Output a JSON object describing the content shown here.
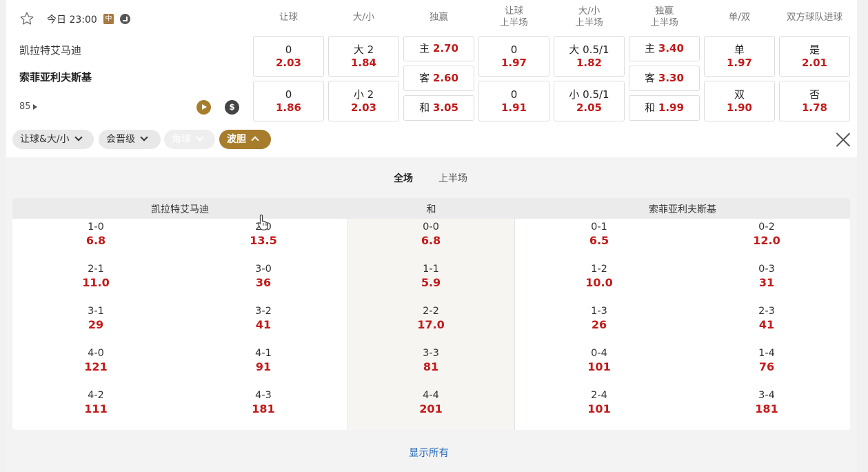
{
  "match": {
    "time": "今日 23:00",
    "badge": "中",
    "home": "凯拉特艾马迪",
    "away": "索菲亚利夫斯基",
    "minute": "85"
  },
  "headers": [
    {
      "l1": "让球",
      "l2": ""
    },
    {
      "l1": "大/小",
      "l2": ""
    },
    {
      "l1": "独赢",
      "l2": ""
    },
    {
      "l1": "让球",
      "l2": "上半场"
    },
    {
      "l1": "大/小",
      "l2": "上半场"
    },
    {
      "l1": "独赢",
      "l2": "上半场"
    },
    {
      "l1": "单/双",
      "l2": ""
    },
    {
      "l1": "双方球队进球",
      "l2": ""
    }
  ],
  "markets": {
    "handicap": [
      {
        "line": "0",
        "odd": "2.03"
      },
      {
        "line": "0",
        "odd": "1.86"
      }
    ],
    "overunder": [
      {
        "line": "大 2",
        "odd": "1.84"
      },
      {
        "line": "小 2",
        "odd": "2.03"
      }
    ],
    "moneyline": [
      {
        "label": "主",
        "odd": "2.70"
      },
      {
        "label": "客",
        "odd": "2.60"
      },
      {
        "label": "和",
        "odd": "3.05"
      }
    ],
    "handicap_h1": [
      {
        "line": "0",
        "odd": "1.97"
      },
      {
        "line": "0",
        "odd": "1.91"
      }
    ],
    "overunder_h1": [
      {
        "line": "大 0.5/1",
        "odd": "1.82"
      },
      {
        "line": "小 0.5/1",
        "odd": "2.05"
      }
    ],
    "moneyline_h1": [
      {
        "label": "主",
        "odd": "3.40"
      },
      {
        "label": "客",
        "odd": "3.30"
      },
      {
        "label": "和",
        "odd": "1.99"
      }
    ],
    "oddeven": [
      {
        "line": "单",
        "odd": "1.97"
      },
      {
        "line": "双",
        "odd": "1.90"
      }
    ],
    "btts": [
      {
        "line": "是",
        "odd": "2.01"
      },
      {
        "line": "否",
        "odd": "1.78"
      }
    ]
  },
  "filters": [
    "让球&大/小",
    "会晋级",
    "角球",
    "波胆"
  ],
  "tabs": {
    "full": "全场",
    "half": "上半场"
  },
  "correct_score": {
    "headers": {
      "home": "凯拉特艾马迪",
      "draw": "和",
      "away": "索菲亚利夫斯基"
    },
    "home": [
      {
        "score": "1-0",
        "odd": "6.8"
      },
      {
        "score": "2-0",
        "odd": "13.5"
      },
      {
        "score": "2-1",
        "odd": "11.0"
      },
      {
        "score": "3-0",
        "odd": "36"
      },
      {
        "score": "3-1",
        "odd": "29"
      },
      {
        "score": "3-2",
        "odd": "41"
      },
      {
        "score": "4-0",
        "odd": "121"
      },
      {
        "score": "4-1",
        "odd": "91"
      },
      {
        "score": "4-2",
        "odd": "111"
      },
      {
        "score": "4-3",
        "odd": "181"
      }
    ],
    "draw": [
      {
        "score": "0-0",
        "odd": "6.8"
      },
      {
        "score": "1-1",
        "odd": "5.9"
      },
      {
        "score": "2-2",
        "odd": "17.0"
      },
      {
        "score": "3-3",
        "odd": "81"
      },
      {
        "score": "4-4",
        "odd": "201"
      }
    ],
    "away": [
      {
        "score": "0-1",
        "odd": "6.5"
      },
      {
        "score": "0-2",
        "odd": "12.0"
      },
      {
        "score": "1-2",
        "odd": "10.0"
      },
      {
        "score": "0-3",
        "odd": "31"
      },
      {
        "score": "1-3",
        "odd": "26"
      },
      {
        "score": "2-3",
        "odd": "41"
      },
      {
        "score": "0-4",
        "odd": "101"
      },
      {
        "score": "1-4",
        "odd": "76"
      },
      {
        "score": "2-4",
        "odd": "101"
      },
      {
        "score": "3-4",
        "odd": "181"
      }
    ]
  },
  "show_all": "显示所有",
  "colors": {
    "odds": "#c41a1a",
    "accent": "#a77d2c",
    "link": "#2a6bb8"
  }
}
